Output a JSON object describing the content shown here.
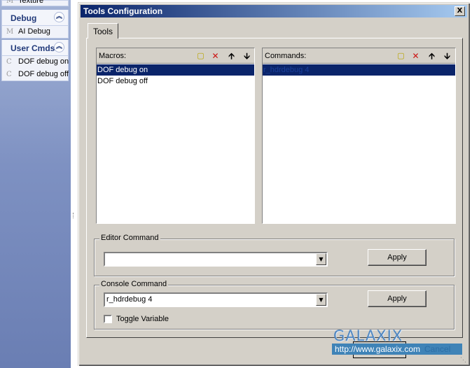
{
  "left_panel": {
    "top_item": {
      "glyph": "M",
      "label": "Texture"
    },
    "debug": {
      "header": "Debug",
      "items": [
        {
          "glyph": "M",
          "label": "AI Debug"
        }
      ]
    },
    "user_cmds": {
      "header": "User Cmds",
      "items": [
        {
          "glyph": "C",
          "label": "DOF debug on"
        },
        {
          "glyph": "C",
          "label": "DOF debug off"
        }
      ]
    }
  },
  "dialog": {
    "title": "Tools Configuration",
    "close_glyph": "X",
    "tab_label": "Tools",
    "macros": {
      "title": "Macros:",
      "items": [
        "DOF debug on",
        "DOF debug off"
      ],
      "selected_index": 0
    },
    "commands": {
      "title": "Commands:",
      "selected_text": "r_hdrdebug 4"
    },
    "editor_command": {
      "label": "Editor Command",
      "value": "",
      "apply_label": "Apply"
    },
    "console_command": {
      "label": "Console Command",
      "value": "r_hdrdebug 4",
      "apply_label": "Apply",
      "toggle_label": "Toggle Variable"
    },
    "cancel_label": "Cancel"
  },
  "watermark": {
    "logo": "GALAXIX",
    "url": "http://www.galaxix.com"
  },
  "icons": {
    "new": "new-item-icon",
    "delete": "delete-icon",
    "up": "move-up-icon",
    "down": "move-down-icon"
  },
  "colors": {
    "dialog_face": "#d4d0c8",
    "title_start": "#0a246a",
    "title_end": "#a6caf0",
    "selection": "#0a246a"
  }
}
